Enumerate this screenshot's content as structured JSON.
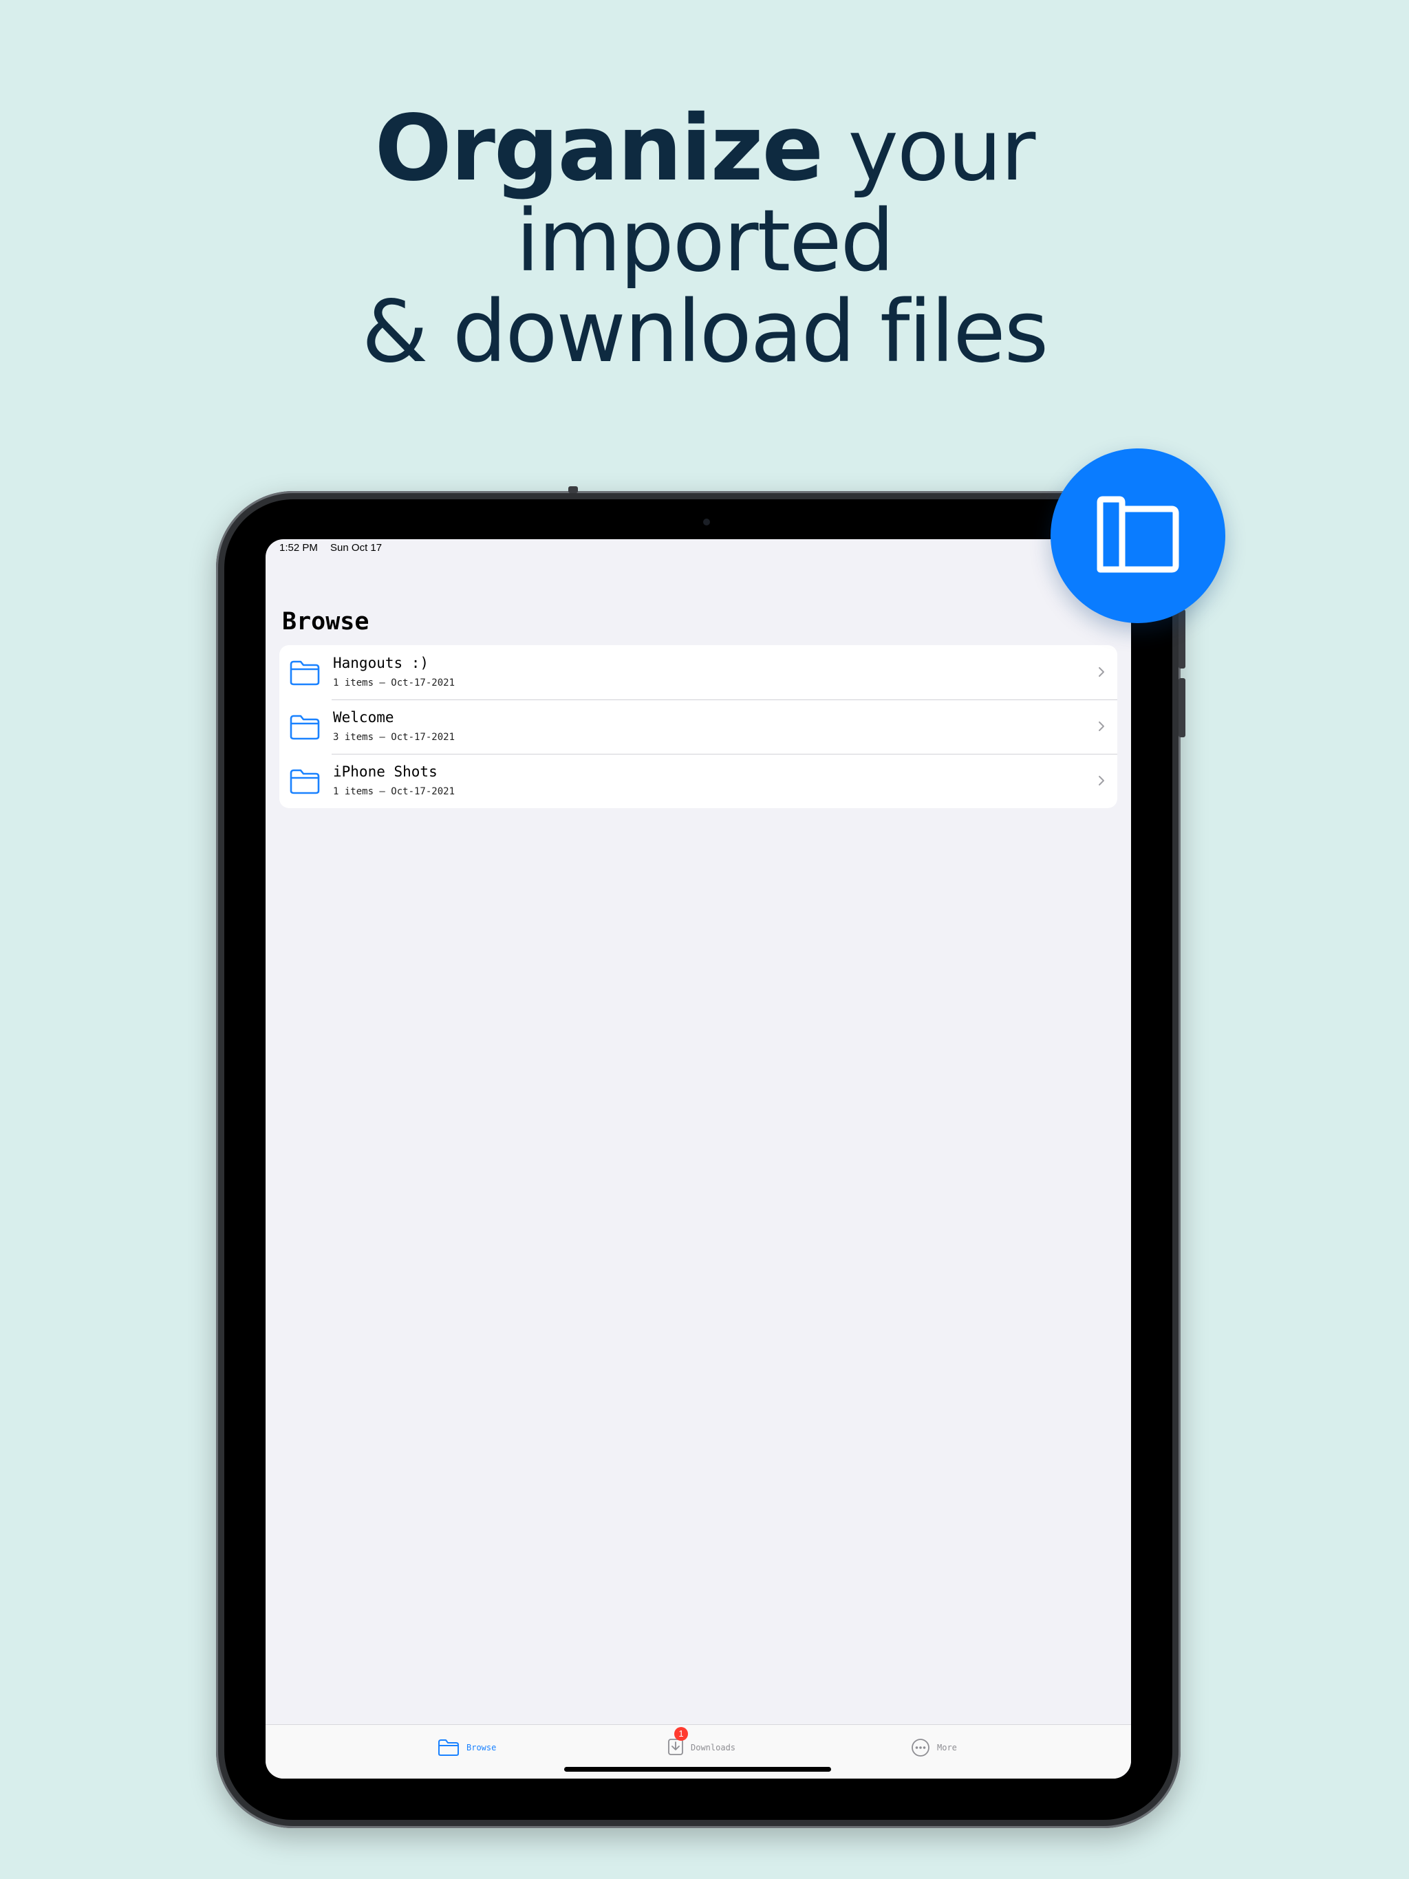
{
  "headline": {
    "line1_strong": "Organize",
    "line1_rest": " your",
    "line2": "imported",
    "line3": "& download files"
  },
  "status_bar": {
    "time": "1:52 PM",
    "date": "Sun Oct 17"
  },
  "screen": {
    "title": "Browse",
    "folders": [
      {
        "name": "Hangouts :)",
        "meta": "1 items – Oct-17-2021",
        "icon": "folder-icon"
      },
      {
        "name": "Welcome",
        "meta": "3 items – Oct-17-2021",
        "icon": "folder-icon"
      },
      {
        "name": "iPhone Shots",
        "meta": "1 items – Oct-17-2021",
        "icon": "folder-icon"
      }
    ]
  },
  "tabbar": {
    "tabs": [
      {
        "label": "Browse",
        "icon": "folder-icon",
        "active": true
      },
      {
        "label": "Downloads",
        "icon": "download-icon",
        "badge": "1"
      },
      {
        "label": "More",
        "icon": "ellipsis-circle-icon"
      }
    ]
  },
  "app_badge": {
    "icon": "folders-stack-icon"
  },
  "colors": {
    "background": "#d8eeec",
    "headline": "#0e2a40",
    "accent": "#0a7cff",
    "badge": "#ff3b30"
  }
}
